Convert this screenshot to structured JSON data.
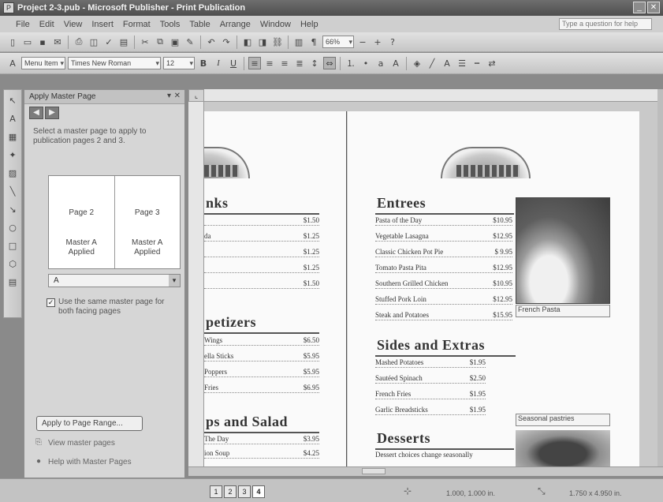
{
  "window": {
    "title": "Project 2-3.pub - Microsoft Publisher - Print Publication"
  },
  "menu": {
    "items": [
      "File",
      "Edit",
      "View",
      "Insert",
      "Format",
      "Tools",
      "Table",
      "Arrange",
      "Window",
      "Help"
    ],
    "ask_placeholder": "Type a question for help"
  },
  "toolbar": {
    "zoom": "66%"
  },
  "format_toolbar": {
    "style": "Menu Item",
    "font": "Times New Roman",
    "size": "12"
  },
  "task_pane": {
    "title": "Apply Master Page",
    "description": "Select a master page to apply to publication pages 2 and 3.",
    "pages": [
      {
        "name": "Page 2",
        "master": "Master A",
        "status": "Applied"
      },
      {
        "name": "Page 3",
        "master": "Master A",
        "status": "Applied"
      }
    ],
    "selected_master": "A",
    "same_master_label": "Use the same master page for both facing pages",
    "same_master_checked": "✓",
    "apply_range_button": "Apply to Page Range...",
    "view_master_link": "View master pages",
    "help_link": "Help with Master Pages"
  },
  "page_left": {
    "drinks_title": "nks",
    "drinks": [
      {
        "name": "",
        "price": "$1.50"
      },
      {
        "name": "da",
        "price": "$1.25"
      },
      {
        "name": "",
        "price": "$1.25"
      },
      {
        "name": "",
        "price": "$1.25"
      },
      {
        "name": "",
        "price": "$1.50"
      }
    ],
    "appetizers_title": "petizers",
    "appetizers": [
      {
        "name": "Wings",
        "price": "$6.50"
      },
      {
        "name": "ella Sticks",
        "price": "$5.95"
      },
      {
        "name": "Poppers",
        "price": "$5.95"
      },
      {
        "name": "Fries",
        "price": "$6.95"
      }
    ],
    "soups_title": "ps and Salad",
    "soups": [
      {
        "name": "The Day",
        "price": "$3.95"
      },
      {
        "name": "ion Soup",
        "price": "$4.25"
      }
    ]
  },
  "page_right": {
    "entrees_title": "Entrees",
    "entrees": [
      {
        "name": "Pasta of the Day",
        "price": "$10.95"
      },
      {
        "name": "Vegetable Lasagna",
        "price": "$12.95"
      },
      {
        "name": "Classic Chicken Pot Pie",
        "price": "$ 9.95"
      },
      {
        "name": "Tomato Pasta Pita",
        "price": "$12.95"
      },
      {
        "name": "Southern Grilled Chicken",
        "price": "$10.95"
      },
      {
        "name": "Stuffed Pork Loin",
        "price": "$12.95"
      },
      {
        "name": "Steak and Potatoes",
        "price": "$15.95"
      }
    ],
    "photo_caption": "French Pasta",
    "sides_title": "Sides and Extras",
    "sides": [
      {
        "name": "Mashed Potatoes",
        "price": "$1.95"
      },
      {
        "name": "Sautéed Spinach",
        "price": "$2.50"
      },
      {
        "name": "French Fries",
        "price": "$1.95"
      },
      {
        "name": "Garlic Breadsticks",
        "price": "$1.95"
      }
    ],
    "desserts_title": "Desserts",
    "desserts_note": "Dessert choices change seasonally",
    "caption2": "Seasonal pastries"
  },
  "status": {
    "pages": [
      "1",
      "2",
      "3",
      "4"
    ],
    "position": "1.000, 1.000 in.",
    "size": "1.750 x 4.950 in."
  }
}
